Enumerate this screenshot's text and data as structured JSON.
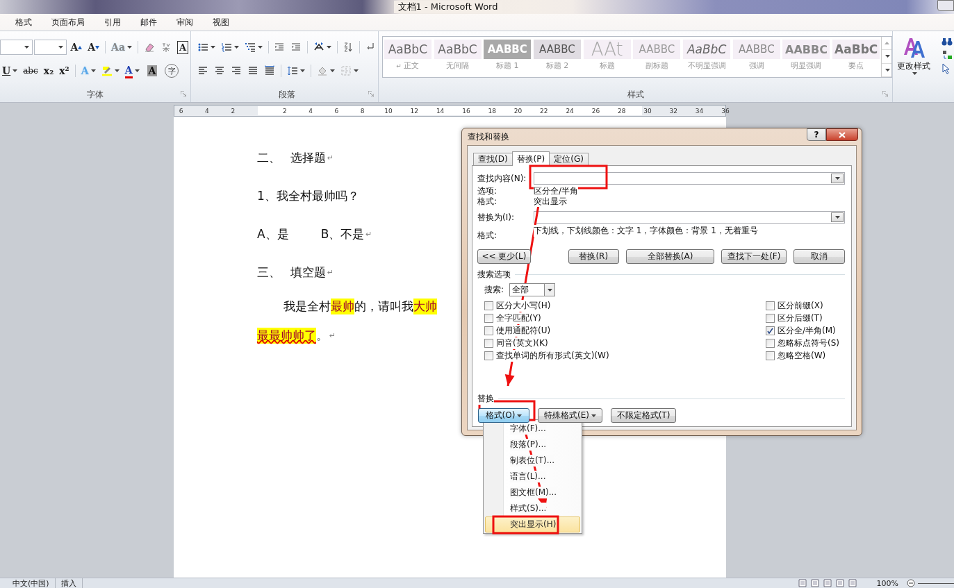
{
  "window": {
    "title": "文档1 - Microsoft Word"
  },
  "ribbon_tabs": [
    "格式",
    "页面布局",
    "引用",
    "邮件",
    "审阅",
    "视图"
  ],
  "ribbon": {
    "font_group": {
      "label": "字体",
      "glyphs": [
        "A",
        "A",
        "Aa",
        "A",
        "U",
        "abc",
        "x₂",
        "x²",
        "A",
        "A",
        "A",
        "字"
      ]
    },
    "paragraph_group": {
      "label": "段落"
    },
    "styles_group": {
      "label": "样式",
      "styles": [
        {
          "kind": "normal",
          "preview": "AaBbC",
          "name": "正文",
          "mark": "↵"
        },
        {
          "kind": "no-spacing",
          "preview": "AaBbC",
          "name": "无间隔"
        },
        {
          "kind": "heading-1",
          "preview": "AABBC",
          "name": "标题 1"
        },
        {
          "kind": "heading-2",
          "preview": "AABBC",
          "name": "标题 2"
        },
        {
          "kind": "title",
          "preview": "AAt",
          "name": "标题"
        },
        {
          "kind": "subtitle",
          "preview": "AABBC",
          "name": "副标题"
        },
        {
          "kind": "subtle-emphasis",
          "preview": "AaBbC",
          "name": "不明显强调"
        },
        {
          "kind": "emphasis",
          "preview": "AABBC",
          "name": "强调"
        },
        {
          "kind": "intense-emphasis",
          "preview": "AABBC",
          "name": "明显强调"
        },
        {
          "kind": "strong",
          "preview": "AaBbC",
          "name": "要点"
        }
      ]
    },
    "change_styles": {
      "label": "更改样式"
    }
  },
  "ruler": {
    "left_numbers": [
      "6",
      "4",
      "2"
    ],
    "numbers": [
      "2",
      "4",
      "6",
      "8",
      "10",
      "12",
      "14",
      "16",
      "18",
      "20",
      "22",
      "24",
      "26",
      "28",
      "30",
      "32",
      "34",
      "36"
    ]
  },
  "document": {
    "lines": [
      {
        "kind": "heading",
        "number": "二、",
        "text": "选择题",
        "end_mark": "↵"
      },
      {
        "kind": "plain",
        "text": "1、我全村最帅吗？"
      },
      {
        "kind": "options",
        "options": [
          "A、是",
          "B、不是"
        ],
        "end_mark": "↵"
      },
      {
        "kind": "heading",
        "number": "三、",
        "text": "填空题",
        "end_mark": "↵"
      },
      {
        "kind": "paragraph",
        "rows": [
          {
            "segments": [
              {
                "text": "我是全村",
                "highlight": false,
                "spelling_error": false
              },
              {
                "text": "最帅",
                "highlight": true,
                "spelling_error": false
              },
              {
                "text": "的，请叫我",
                "highlight": false,
                "spelling_error": false
              },
              {
                "text": "大帅",
                "highlight": true,
                "spelling_error": false
              }
            ]
          },
          {
            "segments": [
              {
                "text": "最最帅帅了",
                "highlight": true,
                "spelling_error": true
              },
              {
                "text": "。",
                "highlight": false,
                "spelling_error": false
              }
            ],
            "end_mark": "↵"
          }
        ]
      }
    ]
  },
  "dialog": {
    "title": "查找和替换",
    "help_button": "?",
    "tabs": [
      {
        "label": "查找(D)",
        "selected": false
      },
      {
        "label": "替换(P)",
        "selected": true
      },
      {
        "label": "定位(G)",
        "selected": false
      }
    ],
    "find": {
      "label": "查找内容(N):"
    },
    "find_options": {
      "label": "选项:",
      "value": "区分全/半角"
    },
    "find_format": {
      "label": "格式:",
      "value": "突出显示"
    },
    "replace": {
      "label": "替换为(I):"
    },
    "replace_format": {
      "label": "格式:",
      "value": "下划线，下划线颜色：文字 1，字体颜色：背景 1，无着重号"
    },
    "buttons": [
      "<< 更少(L)",
      "替换(R)",
      "全部替换(A)",
      "查找下一处(F)",
      "取消"
    ],
    "search_options": {
      "legend": "搜索选项",
      "search_label": "搜索:",
      "search_value": "全部",
      "left": [
        {
          "label": "区分大小写(H)",
          "checked": false
        },
        {
          "label": "全字匹配(Y)",
          "checked": false
        },
        {
          "label": "使用通配符(U)",
          "checked": false
        },
        {
          "label": "同音(英文)(K)",
          "checked": false
        },
        {
          "label": "查找单词的所有形式(英文)(W)",
          "checked": false
        }
      ],
      "right": [
        {
          "label": "区分前缀(X)",
          "checked": false
        },
        {
          "label": "区分后缀(T)",
          "checked": false
        },
        {
          "label": "区分全/半角(M)",
          "checked": true
        },
        {
          "label": "忽略标点符号(S)",
          "checked": false
        },
        {
          "label": "忽略空格(W)",
          "checked": false
        }
      ]
    },
    "replace_section": {
      "legend": "替换",
      "buttons": [
        {
          "label": "格式(O)",
          "dropdown": true,
          "pressed": true
        },
        {
          "label": "特殊格式(E)",
          "dropdown": true,
          "pressed": false
        },
        {
          "label": "不限定格式(T)",
          "dropdown": false,
          "pressed": false
        }
      ]
    }
  },
  "format_menu": {
    "items": [
      {
        "label": "字体(F)...",
        "selected": false
      },
      {
        "label": "段落(P)...",
        "selected": false
      },
      {
        "label": "制表位(T)...",
        "selected": false
      },
      {
        "label": "语言(L)...",
        "selected": false
      },
      {
        "label": "图文框(M)...",
        "selected": false
      },
      {
        "label": "样式(S)...",
        "selected": false
      },
      {
        "label": "突出显示(H)",
        "selected": true
      }
    ]
  },
  "status_bar": {
    "language": "中文(中国)",
    "mode": "插入",
    "zoom": "100%"
  }
}
